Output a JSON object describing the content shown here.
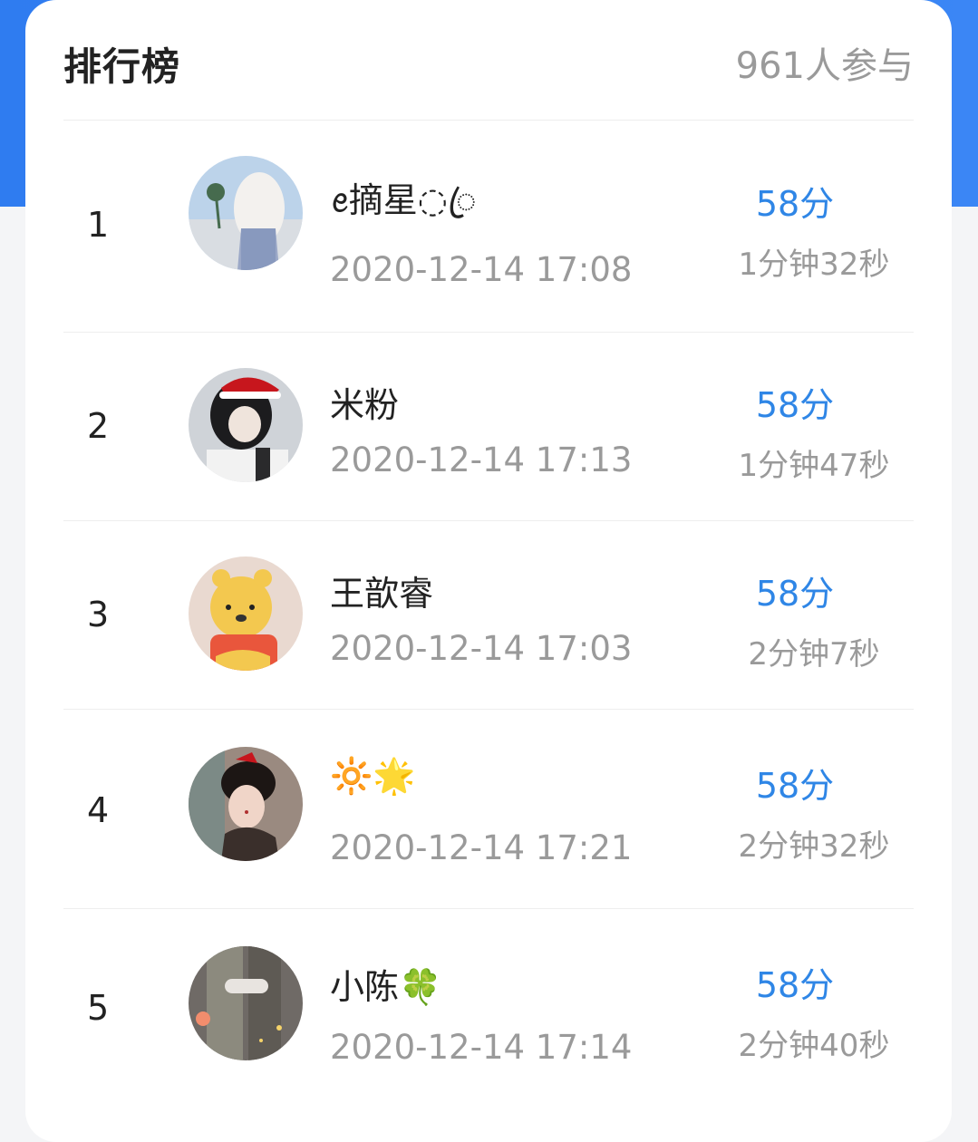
{
  "leaderboard": {
    "title": "排行榜",
    "participants": "961人参与",
    "entries": [
      {
        "rank": "1",
        "name": "ꫀ摘星◌ꦿ",
        "datetime": "2020-12-14 17:08",
        "score": "58分",
        "duration": "1分钟32秒"
      },
      {
        "rank": "2",
        "name": "米粉",
        "datetime": "2020-12-14 17:13",
        "score": "58分",
        "duration": "1分钟47秒"
      },
      {
        "rank": "3",
        "name": "王歆睿",
        "datetime": "2020-12-14 17:03",
        "score": "58分",
        "duration": "2分钟7秒"
      },
      {
        "rank": "4",
        "name": "🔆🌟",
        "datetime": "2020-12-14 17:21",
        "score": "58分",
        "duration": "2分钟32秒"
      },
      {
        "rank": "5",
        "name": "小陈🍀",
        "datetime": "2020-12-14 17:14",
        "score": "58分",
        "duration": "2分钟40秒"
      }
    ]
  }
}
